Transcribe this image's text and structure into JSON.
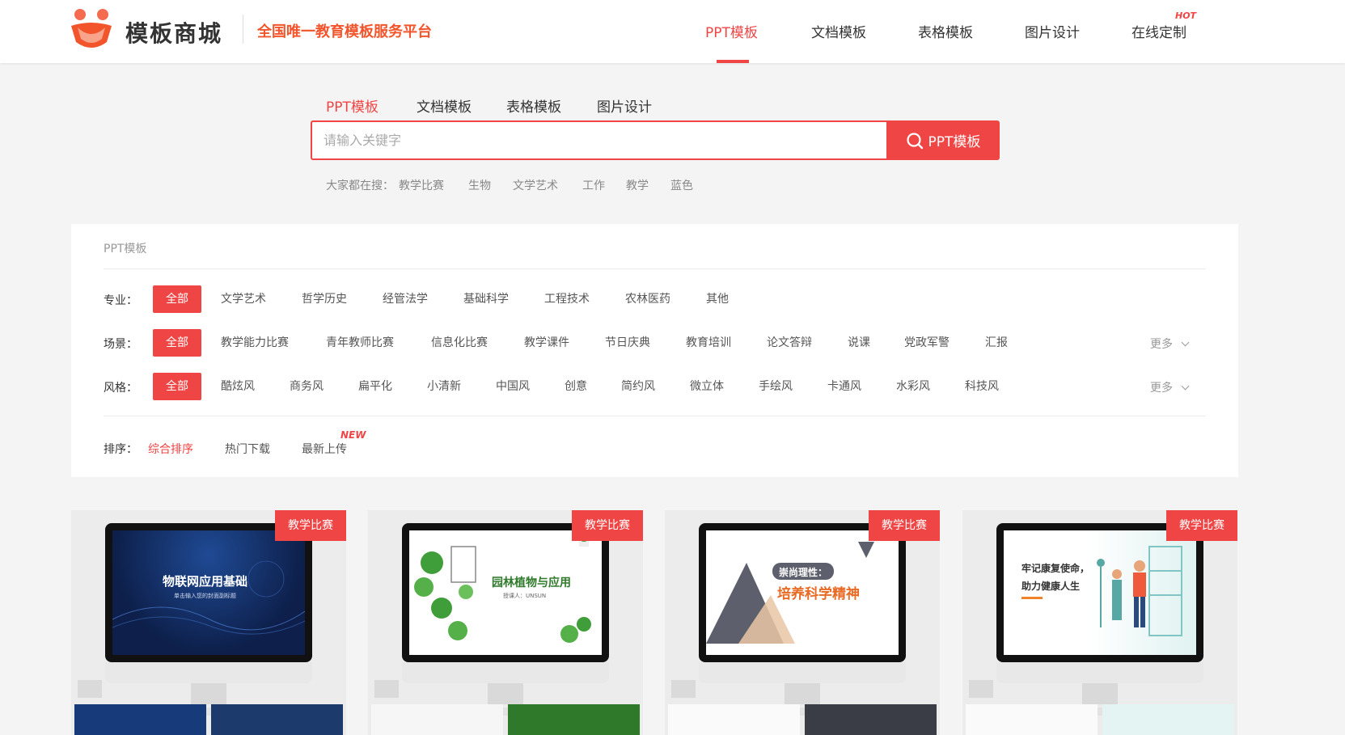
{
  "header": {
    "brand": "模板商城",
    "slogan": "全国唯一教育模板服务平台",
    "nav": [
      "PPT模板",
      "文档模板",
      "表格模板",
      "图片设计",
      "在线定制"
    ],
    "hot_tag": "HOT"
  },
  "search": {
    "tabs": [
      "PPT模板",
      "文档模板",
      "表格模板",
      "图片设计"
    ],
    "placeholder": "请输入关键字",
    "button_label": "PPT模板",
    "hot_prefix": "大家都在搜：",
    "hot_words": [
      "教学比赛",
      "生物",
      "文学艺术",
      "工作",
      "教学",
      "蓝色"
    ]
  },
  "filters": {
    "title": "PPT模板",
    "major_label": "专业：",
    "major": [
      "全部",
      "文学艺术",
      "哲学历史",
      "经管法学",
      "基础科学",
      "工程技术",
      "农林医药",
      "其他"
    ],
    "scene_label": "场景：",
    "scene": [
      "全部",
      "教学能力比赛",
      "青年教师比赛",
      "信息化比赛",
      "教学课件",
      "节日庆典",
      "教育培训",
      "论文答辩",
      "说课",
      "党政军警",
      "汇报"
    ],
    "style_label": "风格：",
    "style": [
      "全部",
      "酷炫风",
      "商务风",
      "扁平化",
      "小清新",
      "中国风",
      "创意",
      "简约风",
      "微立体",
      "手绘风",
      "卡通风",
      "水彩风",
      "科技风"
    ],
    "more": "更多",
    "sort_label": "排序：",
    "sort": [
      "综合排序",
      "热门下载",
      "最新上传"
    ],
    "new_tag": "NEW"
  },
  "cards": [
    {
      "badge": "教学比赛",
      "title": "物联网应用基础",
      "subtitle": "单击输入您的封面副标题"
    },
    {
      "badge": "教学比赛",
      "title": "园林植物与应用",
      "subtitle": "授课人：UNSUN"
    },
    {
      "badge": "教学比赛",
      "title": "培养科学精神",
      "subtitle": "崇尚理性："
    },
    {
      "badge": "教学比赛",
      "title": "牢记康复使命，",
      "subtitle": "助力健康人生"
    }
  ],
  "colors": {
    "accent": "#f04545",
    "slogan": "#f2552c"
  }
}
